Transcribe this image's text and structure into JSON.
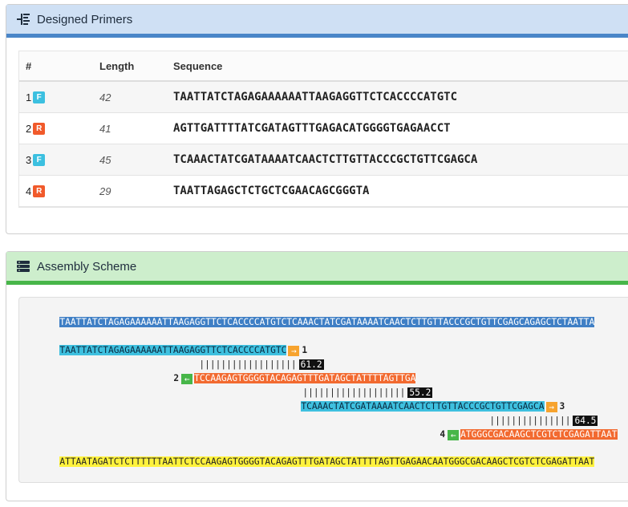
{
  "primers_panel": {
    "title": "Designed Primers",
    "icon": "list-tree-icon",
    "columns": [
      "#",
      "Length",
      "Sequence"
    ],
    "rows": [
      {
        "num": "1",
        "badge": "F",
        "length": "42",
        "sequence": "TAATTATCTAGAGAAAAAATTAAGAGGTTCTCACCCCATGTC"
      },
      {
        "num": "2",
        "badge": "R",
        "length": "41",
        "sequence": "AGTTGATTTTATCGATAGTTTGAGACATGGGGTGAGAACCT"
      },
      {
        "num": "3",
        "badge": "F",
        "length": "45",
        "sequence": "TCAAACTATCGATAAAATCAACTCTTGTTACCCGCTGTTCGAGCA"
      },
      {
        "num": "4",
        "badge": "R",
        "length": "29",
        "sequence": "TAATTAGAGCTCTGCTCGAACAGCGGGTA"
      }
    ]
  },
  "assembly_panel": {
    "title": "Assembly Scheme",
    "icon": "server-stack-icon",
    "template_top": "TAATTATCTAGAGAAAAAATTAAGAGGTTCTCACCCCATGTCTCAAACTATCGATAAAATCAACTCTTGTTACCCGCTGTTCGAGCAGAGCTCTAATTA",
    "primer1": {
      "seq": "TAATTATCTAGAGAAAAAATTAAGAGGTTCTCACCCCATGTC",
      "label": "1",
      "arrow": "→"
    },
    "overlap1": {
      "bars": "||||||||||||||||||",
      "tm": "61.2"
    },
    "primer2": {
      "seq": "TCCAAGAGTGGGGTACAGAGTTTGATAGCTATTTTAGTTGA",
      "label": "2",
      "arrow": "←"
    },
    "overlap2": {
      "bars": "|||||||||||||||||||",
      "tm": "55.2"
    },
    "primer3": {
      "seq": "TCAAACTATCGATAAAATCAACTCTTGTTACCCGCTGTTCGAGCA",
      "label": "3",
      "arrow": "→"
    },
    "overlap3": {
      "bars": "|||||||||||||||",
      "tm": "64.5"
    },
    "primer4": {
      "seq": "ATGGGCGACAAGCTCGTCTCGAGATTAAT",
      "label": "4",
      "arrow": "←"
    },
    "template_bottom": "ATTAATAGATCTCTTTTTTAATTCTCCAAGAGTGGGGTACAGAGTTTGATAGCTATTTTAGTTGAGAACAATGGGCGACAAGCTCGTCTCGAGATTAAT"
  },
  "colors": {
    "primers_header_bg": "#cfe0f4",
    "primers_header_border": "#4a86c8",
    "assembly_header_bg": "#cdeecc",
    "assembly_header_border": "#47b649",
    "forward_badge": "#3cc0e0",
    "reverse_badge": "#f15a2b"
  }
}
